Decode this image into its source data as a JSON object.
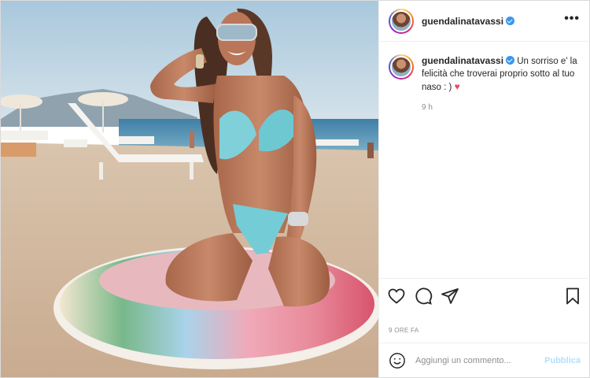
{
  "post": {
    "username": "guendalinatavassi",
    "verified": true,
    "more_label": "•••"
  },
  "caption": {
    "username": "guendalinatavassi",
    "text": "Un sorriso e' la felicità che troverai proprio sotto al tuo naso : )",
    "emoji": "♥",
    "time": "9 h"
  },
  "actions": {
    "like_icon": "heart-icon",
    "comment_icon": "comment-icon",
    "share_icon": "share-icon",
    "save_icon": "bookmark-icon"
  },
  "date_label": "9 ORE FA",
  "comment_box": {
    "placeholder": "Aggiungi un commento...",
    "publish_label": "Pubblica"
  },
  "colors": {
    "accent_blue": "#3897f0",
    "publish_disabled": "#b2dffc",
    "heart_red": "#ed4956",
    "border": "#dbdbdb"
  }
}
